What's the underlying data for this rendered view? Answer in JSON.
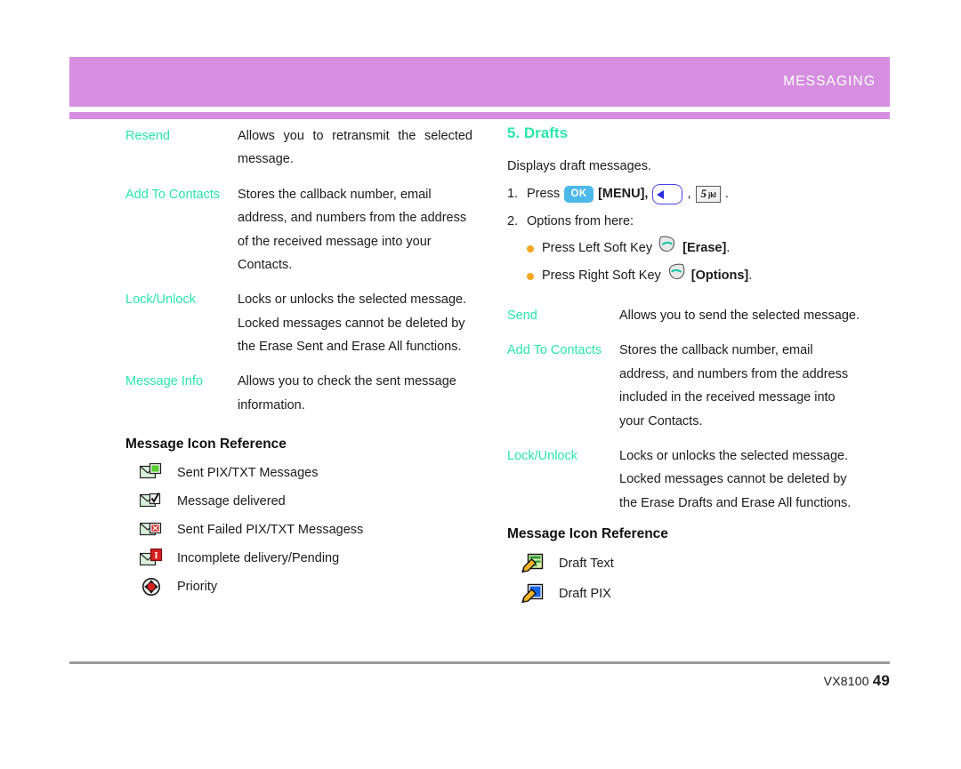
{
  "header": {
    "title": "MESSAGING",
    "bar_color": "#d68fe0",
    "title_color": "#ffffff"
  },
  "accent_color": "#2ae6a6",
  "bullet_color": "#f5a623",
  "left_column": {
    "definitions": [
      {
        "term": "Resend",
        "desc": "Allows you to retransmit the selected message."
      },
      {
        "term": "Add To Contacts",
        "desc": "Stores the callback number, email address, and numbers from the address of the received message into your Contacts."
      },
      {
        "term": "Lock/Unlock",
        "desc": "Locks or unlocks the selected message. Locked messages cannot be deleted by the Erase Sent and Erase All functions."
      },
      {
        "term": "Message Info",
        "desc": "Allows you to check the sent message information."
      }
    ],
    "icon_reference": {
      "heading": "Message Icon Reference",
      "items": [
        {
          "icon": "sent-pix-txt-icon",
          "label": "Sent PIX/TXT Messages"
        },
        {
          "icon": "message-delivered-icon",
          "label": "Message delivered"
        },
        {
          "icon": "sent-failed-icon",
          "label": "Sent Failed PIX/TXT Messagess"
        },
        {
          "icon": "incomplete-delivery-icon",
          "label": "Incomplete delivery/Pending"
        },
        {
          "icon": "priority-icon",
          "label": "Priority"
        }
      ]
    }
  },
  "right_column": {
    "section_title": "5. Drafts",
    "intro": "Displays draft messages.",
    "steps": [
      {
        "number": "1.",
        "prefix": "Press",
        "ok_key": "OK",
        "menu_label": "[MENU],",
        "nav_key": "nav-left-key",
        "comma": ",",
        "num_key_digit": "5",
        "num_key_letters": "jkl",
        "period": "."
      },
      {
        "number": "2.",
        "text": "Options from here:"
      }
    ],
    "bullets": [
      {
        "text": "Press Left Soft Key",
        "key": "left-soft-key",
        "bracket": "[Erase]",
        "tail": "."
      },
      {
        "text": "Press Right Soft Key",
        "key": "right-soft-key",
        "bracket": "[Options]",
        "tail": "."
      }
    ],
    "definitions": [
      {
        "term": "Send",
        "desc": "Allows you to send the selected message."
      },
      {
        "term": "Add To Contacts",
        "desc": "Stores the callback number, email address, and numbers from the address included in the received message into your Contacts."
      },
      {
        "term": "Lock/Unlock",
        "desc": "Locks or unlocks the selected message. Locked messages cannot be deleted by the Erase Drafts and Erase All functions."
      }
    ],
    "icon_reference": {
      "heading": "Message Icon Reference",
      "items": [
        {
          "icon": "draft-text-icon",
          "label": "Draft Text"
        },
        {
          "icon": "draft-pix-icon",
          "label": "Draft PIX"
        }
      ]
    }
  },
  "footer": {
    "model": "VX8100",
    "page_number": "49"
  }
}
